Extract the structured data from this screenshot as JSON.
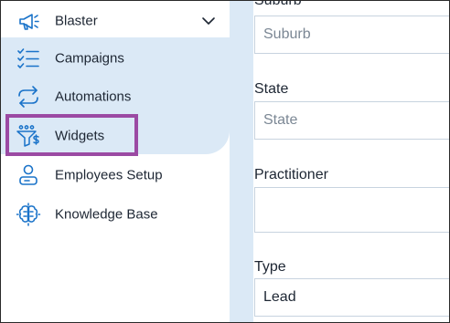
{
  "sidebar": {
    "top_item": {
      "label": "Blaster",
      "icon": "megaphone-icon"
    },
    "items": [
      {
        "label": "Campaigns",
        "icon": "checklist-icon"
      },
      {
        "label": "Automations",
        "icon": "cycle-arrows-icon"
      },
      {
        "label": "Widgets",
        "icon": "funnel-dollar-icon"
      },
      {
        "label": "Employees Setup",
        "icon": "user-card-icon"
      },
      {
        "label": "Knowledge Base",
        "icon": "brain-icon"
      }
    ]
  },
  "form": {
    "suburb": {
      "label": "Suburb",
      "placeholder": "Suburb"
    },
    "state": {
      "label": "State",
      "placeholder": "State"
    },
    "practitioner": {
      "label": "Practitioner",
      "value": ""
    },
    "type": {
      "label": "Type",
      "value": "Lead"
    }
  },
  "colors": {
    "accent_blue": "#1a73c9",
    "nav_highlight_bg": "#dbe9f6",
    "annotation_purple": "#9b4aa3"
  }
}
